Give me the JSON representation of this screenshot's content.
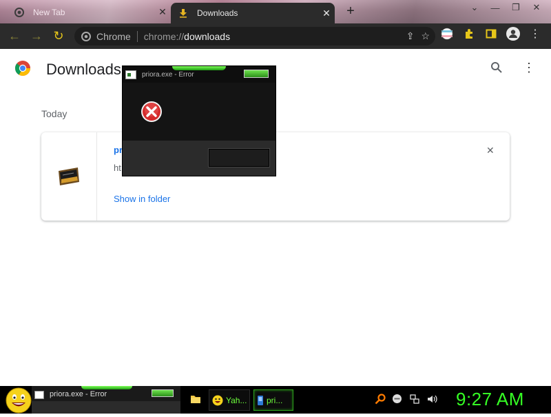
{
  "tabs": [
    {
      "title": "New Tab",
      "active": false
    },
    {
      "title": "Downloads",
      "active": true
    }
  ],
  "toolbar": {
    "omnibox_chip": "Chrome",
    "url_prefix": "chrome://",
    "url_path": "downloads"
  },
  "page": {
    "title": "Downloads",
    "date_group": "Today",
    "download": {
      "filename_visible": "pri",
      "url_visible": "ht",
      "action": "Show in folder"
    }
  },
  "dialog": {
    "title": "priora.exe - Error"
  },
  "taskbar": {
    "preview_title": "priora.exe - Error",
    "buttons": [
      {
        "label": "Yah...",
        "icon": "yahoo-smiley-icon"
      },
      {
        "label": "pri...",
        "icon": "app-icon"
      }
    ],
    "clock": "9:27 AM"
  },
  "colors": {
    "link_blue": "#1a73e8",
    "taskbar_green": "#35ff24",
    "toolbar_dark": "#2b2b2b"
  }
}
